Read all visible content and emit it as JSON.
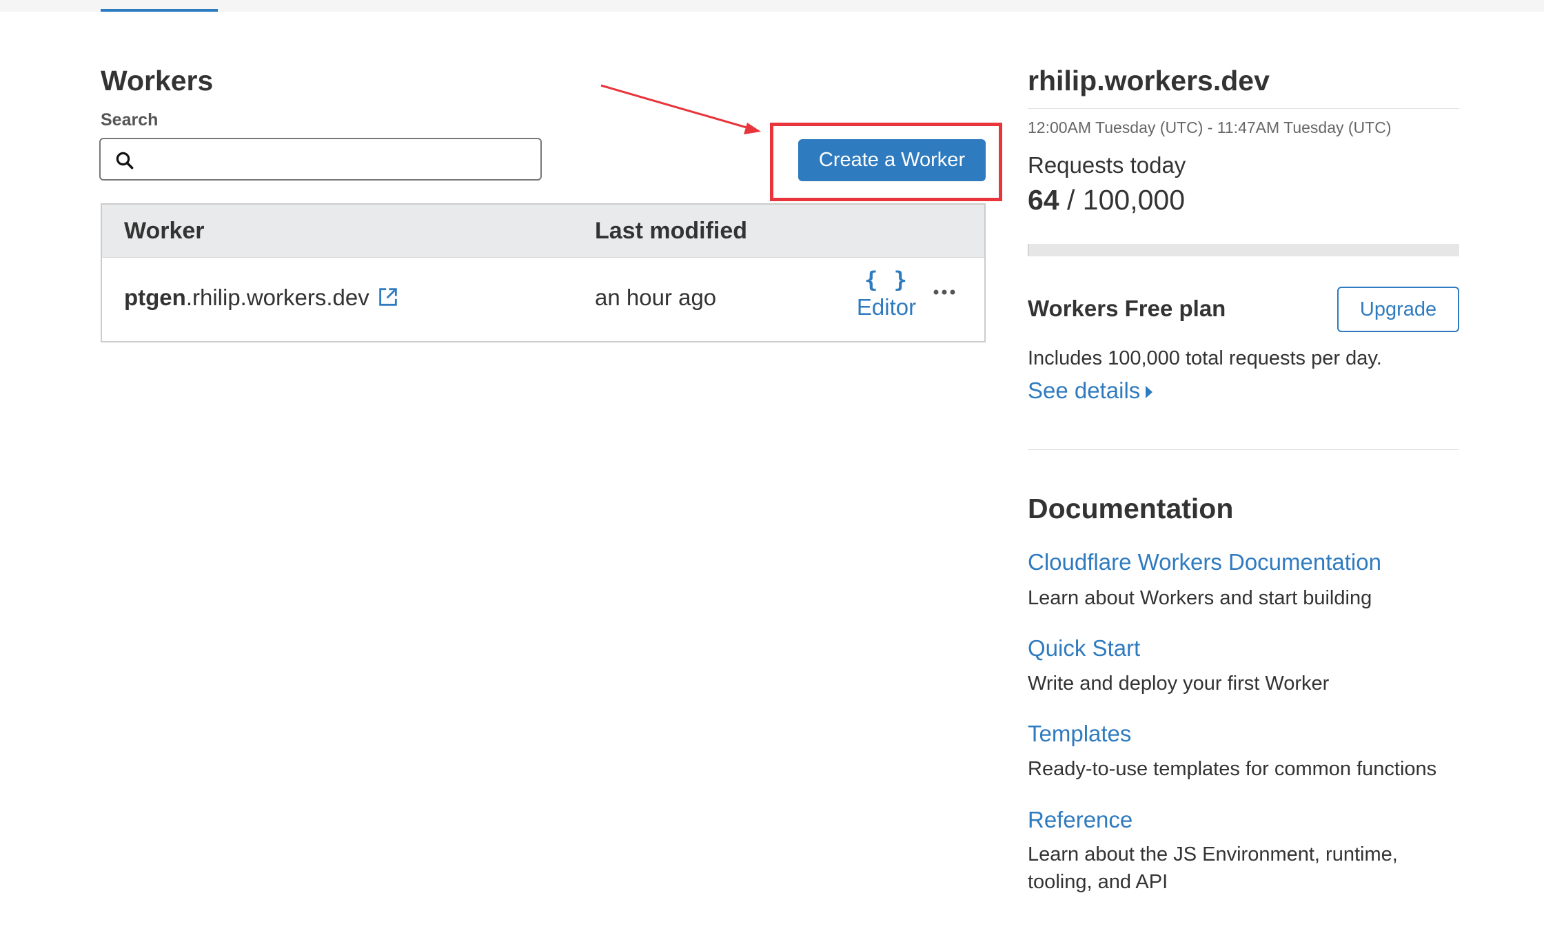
{
  "page": {
    "title": "Workers",
    "search": {
      "label": "Search",
      "value": "",
      "placeholder": ""
    },
    "create_button_label": "Create a Worker"
  },
  "table": {
    "columns": [
      "Worker",
      "Last modified"
    ],
    "rows": [
      {
        "name_strong": "ptgen",
        "name_rest": ".rhilip.workers.dev",
        "last_modified": "an hour ago",
        "editor_icon": "{ }",
        "editor_label": "Editor"
      }
    ]
  },
  "account": {
    "subdomain": "rhilip.workers.dev",
    "time_range": "12:00AM Tuesday (UTC) - 11:47AM Tuesday (UTC)",
    "requests_label": "Requests today",
    "requests_used": "64",
    "requests_separator": " / ",
    "requests_limit": "100,000",
    "usage_fraction": 0.00064
  },
  "plan": {
    "name": "Workers Free plan",
    "upgrade_label": "Upgrade",
    "description": "Includes 100,000 total requests per day.",
    "details_link": "See details"
  },
  "documentation": {
    "title": "Documentation",
    "items": [
      {
        "link": "Cloudflare Workers Documentation",
        "description": "Learn about Workers and start building"
      },
      {
        "link": "Quick Start",
        "description": "Write and deploy your first Worker"
      },
      {
        "link": "Templates",
        "description": "Ready-to-use templates for common functions"
      },
      {
        "link": "Reference",
        "description": "Learn about the JS Environment, runtime, tooling, and API"
      }
    ]
  },
  "icons": {
    "search": "search-icon",
    "external_link": "external-link-icon",
    "editor": "code-braces-icon",
    "more": "more-horizontal-icon",
    "caret": "caret-right-icon"
  },
  "colors": {
    "accent": "#2f7bbf",
    "annotation": "#e8343a",
    "table_header_bg": "#e9eaeb"
  }
}
